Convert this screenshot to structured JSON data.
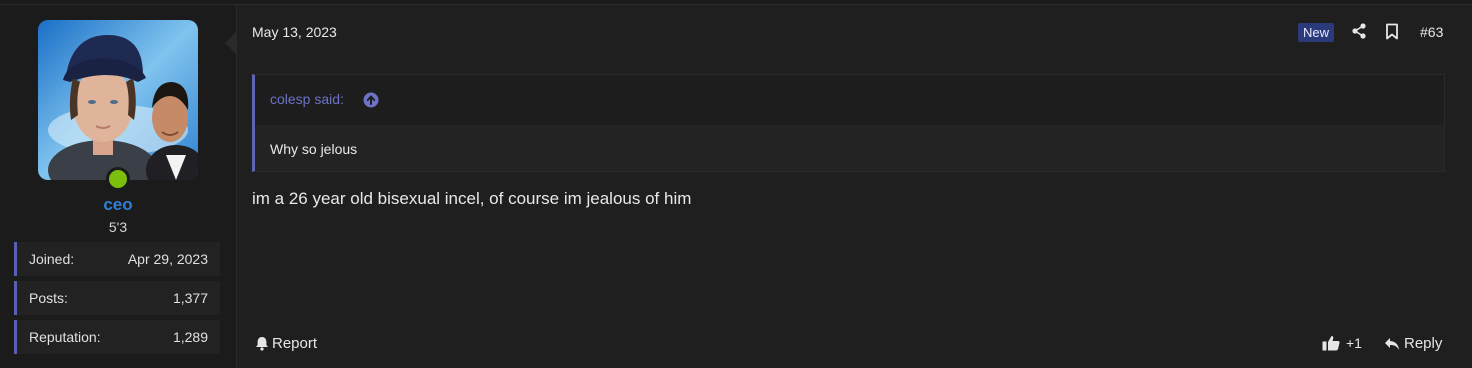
{
  "user": {
    "username": "ceo",
    "title": "5'3",
    "stats": [
      {
        "label": "Joined:",
        "value": "Apr 29, 2023"
      },
      {
        "label": "Posts:",
        "value": "1,377"
      },
      {
        "label": "Reputation:",
        "value": "1,289"
      }
    ],
    "status_color": "#7bbf0c"
  },
  "post": {
    "date": "May 13, 2023",
    "badge": "New",
    "number": "#63",
    "quote": {
      "author_label": "colesp said:",
      "text": "Why so jelous"
    },
    "message": "im a 26 year old bisexual incel, of course im jealous of him",
    "actions": {
      "report": "Report",
      "like_count": "+1",
      "reply": "Reply"
    }
  },
  "colors": {
    "accent": "#5661b3",
    "username": "#2f7fd8",
    "badge_bg": "#2a3a7a"
  }
}
